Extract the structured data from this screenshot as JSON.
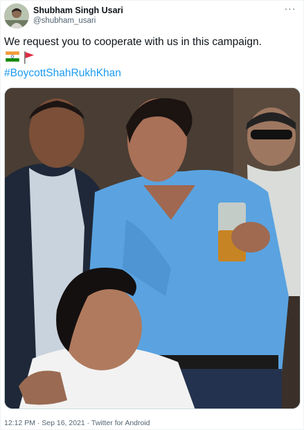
{
  "tweet": {
    "display_name": "Shubham Singh Usari",
    "handle": "@shubham_usari",
    "more_menu": "···",
    "text": "We request you to cooperate with us in this campaign.",
    "emojis": [
      "india-flag",
      "red-triangular-flag"
    ],
    "hashtag": "#BoycottShahRukhKhan",
    "timestamp": "12:12 PM · Sep 16, 2021 · Twitter for Android",
    "avatar_icon": "user-avatar",
    "photo_icon": "photo-four-men-social-event"
  },
  "colors": {
    "link": "#1d9bf0",
    "secondary_text": "#536471",
    "primary_text": "#0f1419"
  }
}
